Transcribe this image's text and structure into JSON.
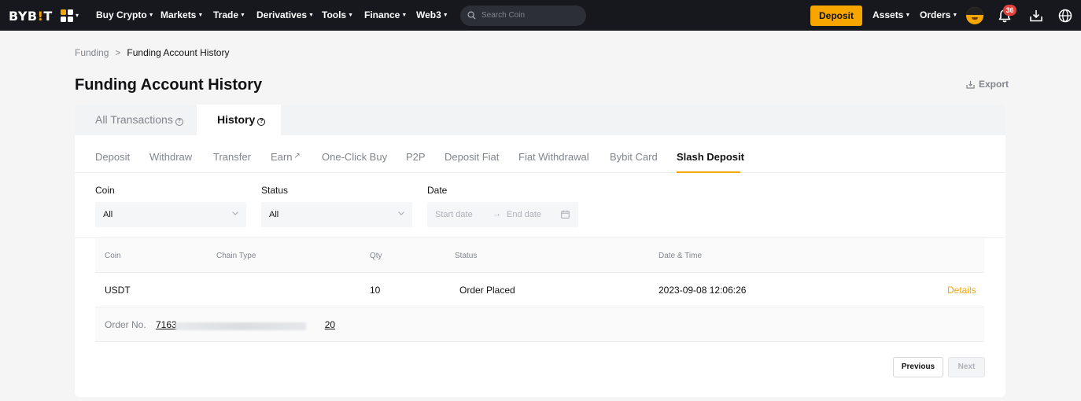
{
  "nav": {
    "logo_prefix": "BYB",
    "logo_bar": "!",
    "logo_suffix": "T",
    "items": [
      {
        "label": "Buy Crypto"
      },
      {
        "label": "Markets"
      },
      {
        "label": "Trade"
      },
      {
        "label": "Derivatives"
      },
      {
        "label": "Tools"
      },
      {
        "label": "Finance"
      },
      {
        "label": "Web3"
      }
    ],
    "search_placeholder": "Search Coin",
    "deposit_label": "Deposit",
    "assets_label": "Assets",
    "orders_label": "Orders",
    "notification_count": "36",
    "accent_color": "#f7a600",
    "icons": [
      "apps-grid-icon",
      "search-icon",
      "avatar",
      "bell-icon",
      "download-icon",
      "globe-icon"
    ]
  },
  "breadcrumb": {
    "root": "Funding",
    "current": "Funding Account History"
  },
  "page": {
    "title": "Funding Account History",
    "export_label": "Export"
  },
  "top_tabs": [
    {
      "label": "All Transactions",
      "active": false
    },
    {
      "label": "History",
      "active": true
    }
  ],
  "sub_tabs": [
    {
      "label": "Deposit"
    },
    {
      "label": "Withdraw"
    },
    {
      "label": "Transfer"
    },
    {
      "label": "Earn"
    },
    {
      "label": "One-Click Buy"
    },
    {
      "label": "P2P"
    },
    {
      "label": "Deposit Fiat"
    },
    {
      "label": "Fiat Withdrawal"
    },
    {
      "label": "Bybit Card"
    },
    {
      "label": "Slash Deposit",
      "active": true
    }
  ],
  "filters": {
    "coin_label": "Coin",
    "coin_value": "All",
    "status_label": "Status",
    "status_value": "All",
    "date_label": "Date",
    "start_placeholder": "Start date",
    "end_placeholder": "End date"
  },
  "table": {
    "columns": [
      "Coin",
      "Chain Type",
      "Qty",
      "Status",
      "Date & Time"
    ],
    "rows": [
      {
        "coin": "USDT",
        "chain_type": "",
        "qty": "10",
        "status": "Order Placed",
        "datetime": "2023-09-08 12:06:26",
        "action": "Details",
        "order_label": "Order No.",
        "order_no_start": "7163",
        "order_no_end": "20"
      }
    ]
  },
  "pagination": {
    "previous": "Previous",
    "next": "Next"
  }
}
